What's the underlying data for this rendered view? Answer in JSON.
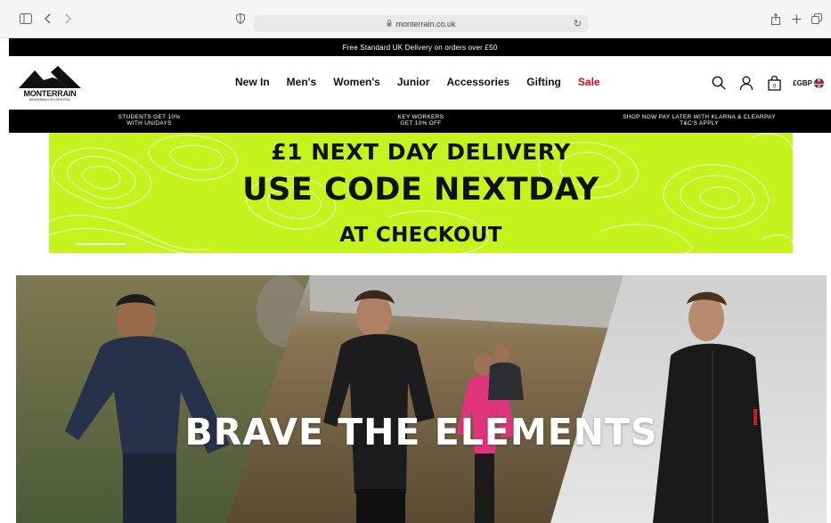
{
  "browser": {
    "url": "monterrain.co.uk"
  },
  "announcement": "Free Standard UK Delivery on orders over £50",
  "brand": {
    "name": "MONTERRAIN",
    "tagline": "MOUNTAIN EXPLORATION"
  },
  "nav": {
    "items": [
      "New In",
      "Men's",
      "Women's",
      "Junior",
      "Accessories",
      "Gifting",
      "Sale"
    ],
    "currency": "£GBP"
  },
  "promo_bar": {
    "left_line1": "STUDENTS GET 10%",
    "left_line2": "WITH UNIDAYS",
    "mid_line1": "KEY WORKERS",
    "mid_line2": "GET 10% OFF",
    "right_line1": "SHOP NOW PAY LATER WITH KLARNA & CLEARPAY",
    "right_line2": "T&C'S APPLY"
  },
  "banner": {
    "line1": "£1 NEXT DAY DELIVERY",
    "line2": "USE CODE NEXTDAY",
    "line3": "AT CHECKOUT",
    "background": "#c6f21d"
  },
  "hero": {
    "title": "BRAVE THE ELEMENTS"
  },
  "colors": {
    "sale": "#e3051b",
    "bar": "#000000"
  }
}
